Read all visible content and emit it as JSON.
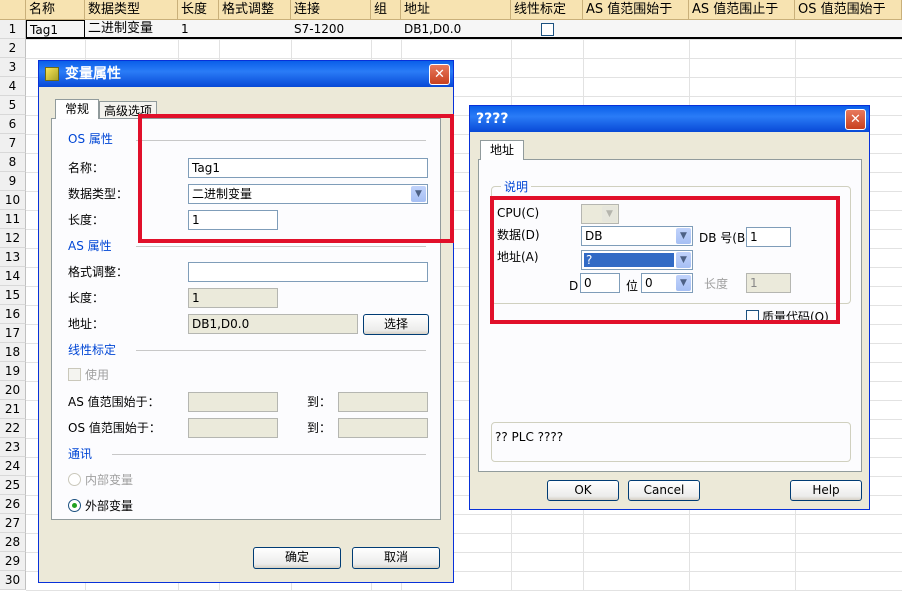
{
  "sheet": {
    "columns": [
      "名称",
      "数据类型",
      "长度",
      "格式调整",
      "连接",
      "组",
      "地址",
      "线性标定",
      "AS 值范围始于",
      "AS 值范围止于",
      "OS 值范围始于"
    ],
    "rows": [
      "1",
      "2",
      "3",
      "4",
      "5",
      "6",
      "7",
      "8",
      "9",
      "10",
      "11",
      "12",
      "13",
      "14",
      "15",
      "16",
      "17",
      "18",
      "19",
      "20",
      "21",
      "22",
      "23",
      "24",
      "25",
      "26",
      "27",
      "28",
      "29",
      "30"
    ],
    "row1": {
      "name": "Tag1",
      "type": "二进制变量",
      "length": "1",
      "connection": "S7-1200",
      "address": "DB1,D0.0"
    }
  },
  "dialog1": {
    "title": "变量属性",
    "tabs": [
      "常规",
      "高级选项"
    ],
    "os_group": "OS 属性",
    "name_label": "名称：",
    "name_value": "Tag1",
    "type_label": "数据类型：",
    "type_value": "二进制变量",
    "length_label": "长度：",
    "length_value": "1",
    "as_group": "AS 属性",
    "format_label": "格式调整：",
    "format_value": "",
    "as_length_label": "长度：",
    "as_length_value": "1",
    "address_label": "地址：",
    "address_value": "DB1,D0.0",
    "select_button": "选择",
    "linear_group": "线性标定",
    "use_label": "使用",
    "as_range_label": "AS 值范围始于：",
    "os_range_label": "OS 值范围始于：",
    "to_label": "到：",
    "comm_group": "通讯",
    "internal_label": "内部变量",
    "external_label": "外部变量",
    "ok_button": "确定",
    "cancel_button": "取消"
  },
  "dialog2": {
    "title": "????",
    "tab": "地址",
    "desc_group": "说明",
    "cpu_label": "CPU(C)",
    "data_label": "数据(D)",
    "data_value": "DB",
    "dbnum_label": "DB 号(B)",
    "dbnum_value": "1",
    "addr_label": "地址(A)",
    "addr_value": "?",
    "d_label": "D",
    "d_value": "0",
    "bit_label": "位",
    "bit_value": "0",
    "len_label": "长度",
    "len_value": "1",
    "quality_label": "质量代码(Q)",
    "status_text": "?? PLC ????",
    "ok_button": "OK",
    "cancel_button": "Cancel",
    "help_button": "Help"
  },
  "colors": {
    "highlight": "#e1102a",
    "header": "#f7e3b1",
    "title": "#0a5fe9",
    "selected": "#316ac5"
  }
}
